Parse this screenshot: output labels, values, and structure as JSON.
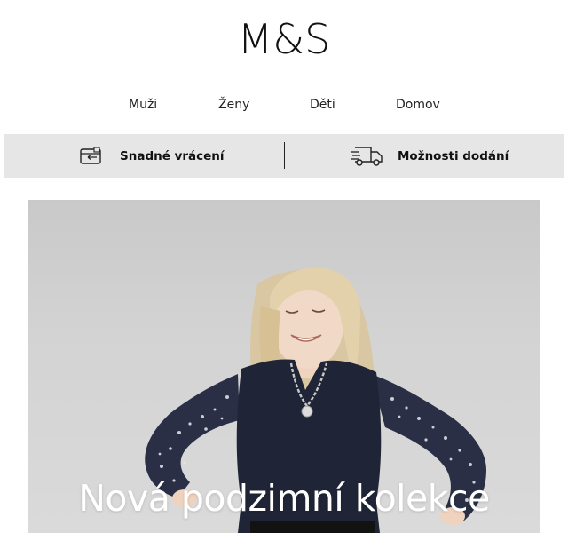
{
  "brand": {
    "logo_text": "M&S"
  },
  "nav": {
    "items": [
      {
        "label": "Muži"
      },
      {
        "label": "Ženy"
      },
      {
        "label": "Děti"
      },
      {
        "label": "Domov"
      }
    ]
  },
  "info_bar": {
    "returns": {
      "label": "Snadné vrácení",
      "icon": "return-box-icon"
    },
    "delivery": {
      "label": "Možnosti dodání",
      "icon": "delivery-truck-icon"
    }
  },
  "hero": {
    "title": "Nová podzimní kolekce",
    "image": "model-in-knit-vest-photo"
  },
  "colors": {
    "info_bar_bg": "#e6e6e6",
    "hero_bg": "#d3d3d3",
    "hero_title": "#ffffff"
  }
}
